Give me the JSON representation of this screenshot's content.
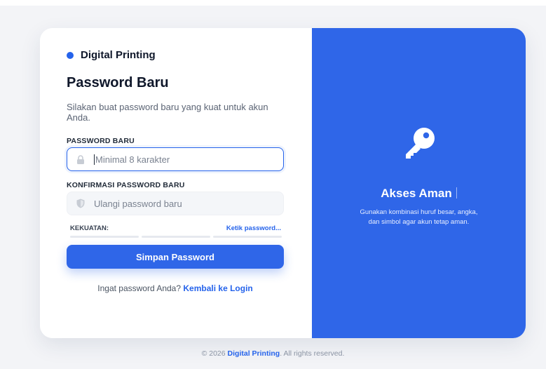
{
  "brand": {
    "name": "Digital Printing"
  },
  "form": {
    "title": "Password Baru",
    "subtitle": "Silakan buat password baru yang kuat untuk akun Anda.",
    "password_label": "PASSWORD BARU",
    "password_placeholder": "Minimal 8 karakter",
    "confirm_label": "KONFIRMASI PASSWORD BARU",
    "confirm_placeholder": "Ulangi password baru",
    "strength_label": "KEKUATAN:",
    "strength_hint": "Ketik password...",
    "submit_label": "Simpan Password",
    "login_prompt": "Ingat password Anda?",
    "login_link": "Kembali ke Login"
  },
  "panel": {
    "title": "Akses Aman",
    "text": "Gunakan kombinasi huruf besar, angka, dan simbol agar akun tetap aman."
  },
  "footer": {
    "prefix": "© 2026",
    "brand": "Digital Printing",
    "suffix": ". All rights reserved."
  },
  "colors": {
    "accent": "#2f66e8",
    "link": "#2563eb"
  },
  "icons": {
    "password_field": "lock-icon",
    "confirm_field": "shield-icon",
    "panel": "key-icon"
  }
}
